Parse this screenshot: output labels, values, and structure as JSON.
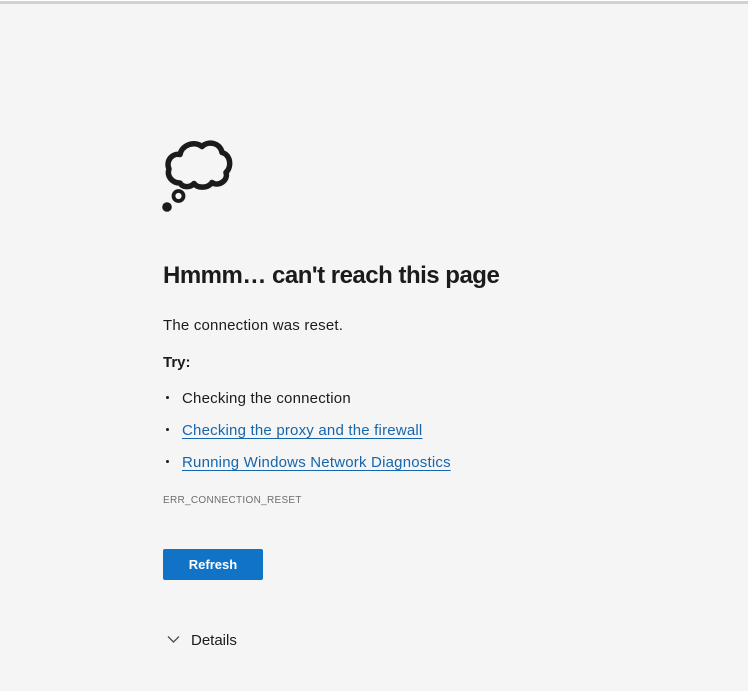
{
  "error_page": {
    "title": "Hmmm… can't reach this page",
    "message": "The connection was reset.",
    "try_label": "Try:",
    "suggestions": [
      {
        "label": "Checking the connection",
        "is_link": false
      },
      {
        "label": "Checking the proxy and the firewall",
        "is_link": true
      },
      {
        "label": "Running Windows Network Diagnostics",
        "is_link": true
      }
    ],
    "error_code": "ERR_CONNECTION_RESET",
    "refresh_button_label": "Refresh",
    "details_label": "Details",
    "icons": {
      "status_icon": "thought-bubble-icon",
      "details_icon": "chevron-down-icon"
    },
    "colors": {
      "background": "#f5f5f5",
      "top_divider": "#d1d1d1",
      "text": "#1b1b1b",
      "link_blue": "#1566ad",
      "button_blue": "#1173c5",
      "muted_gray": "#6e6e6e"
    }
  }
}
